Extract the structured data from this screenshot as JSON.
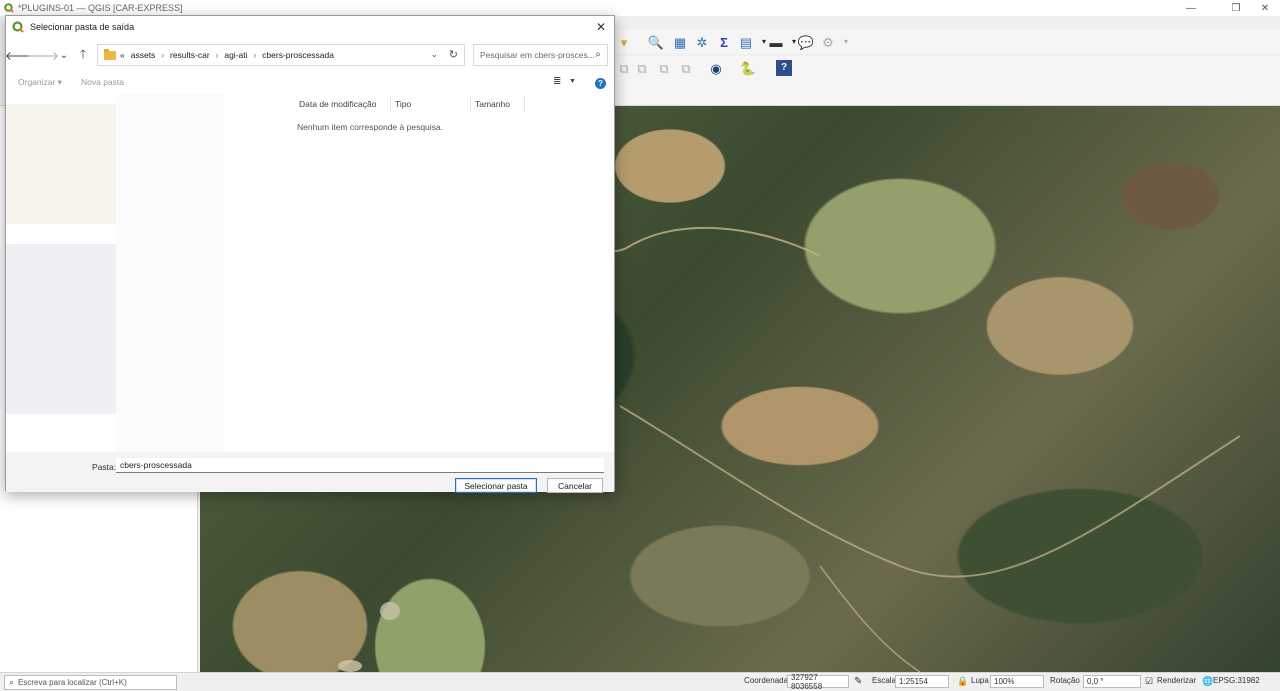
{
  "window": {
    "title": "*PLUGINS-01 — QGIS [CAR-EXPRESS]",
    "minimize": "—",
    "restore": "❐",
    "close": "✕"
  },
  "status": {
    "locator_placeholder": "Escreva para localizar (Ctrl+K)",
    "coord_label": "Coordenada",
    "coord_value": "327927 8036558",
    "scale_label": "Escala",
    "scale_value": "1:25154",
    "magnifier_label": "Lupa",
    "magnifier_value": "100%",
    "rotation_label": "Rotação",
    "rotation_value": "0,0 °",
    "render_label": "Renderizar",
    "render_checked": true,
    "crs": "EPSG:31982"
  },
  "dialog": {
    "title": "Selecionar pasta de saída",
    "close": "✕",
    "breadcrumb": [
      "«",
      "assets",
      "results-car",
      "agi-ati",
      "cbers-proscessada"
    ],
    "search_placeholder": "Pesquisar em cbers-prosces...",
    "organize": "Organizar ▾",
    "new_folder": "Nova pasta",
    "columns": [
      "Data de modificação",
      "Tipo",
      "Tamanho"
    ],
    "empty_message": "Nenhum item corresponde à pesquisa.",
    "folder_label": "Pasta:",
    "folder_value": "cbers-proscessada",
    "select_button": "Selecionar pasta",
    "cancel_button": "Cancelar"
  },
  "icons": {
    "back": "🡐",
    "forward": "🡒",
    "recent": "⌄",
    "up": "🡑",
    "refresh": "↻",
    "search": "⌕",
    "view": "≣",
    "help": "?"
  }
}
